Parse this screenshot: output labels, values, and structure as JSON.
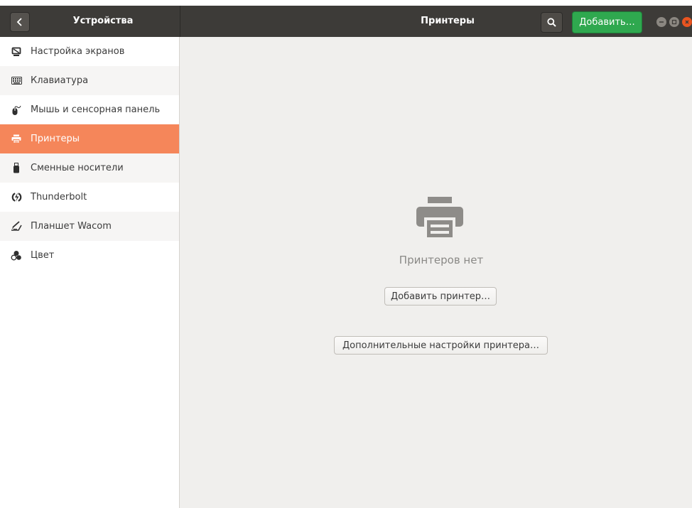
{
  "header": {
    "back_icon": "chevron-left-icon",
    "sidebar_title": "Устройства",
    "page_title": "Принтеры",
    "search_icon": "search-icon",
    "add_label": "Добавить…",
    "add_color": "#2fa84f",
    "window_controls": [
      "minimize-icon",
      "maximize-icon",
      "close-icon"
    ]
  },
  "sidebar": {
    "items": [
      {
        "label": "Настройка экранов",
        "icon": "display-icon"
      },
      {
        "label": "Клавиатура",
        "icon": "keyboard-icon"
      },
      {
        "label": "Мышь и сенсорная панель",
        "icon": "mouse-icon"
      },
      {
        "label": "Принтеры",
        "icon": "printer-icon",
        "selected": true
      },
      {
        "label": "Сменные носители",
        "icon": "usb-icon"
      },
      {
        "label": "Thunderbolt",
        "icon": "thunderbolt-icon"
      },
      {
        "label": "Планшет Wacom",
        "icon": "tablet-icon"
      },
      {
        "label": "Цвет",
        "icon": "color-icon"
      }
    ],
    "selected_color": "#f5865a"
  },
  "main": {
    "empty_icon": "printer-icon",
    "empty_text": "Принтеров нет",
    "add_printer_label": "Добавить принтер…",
    "advanced_label": "Дополнительные настройки принтера…"
  }
}
